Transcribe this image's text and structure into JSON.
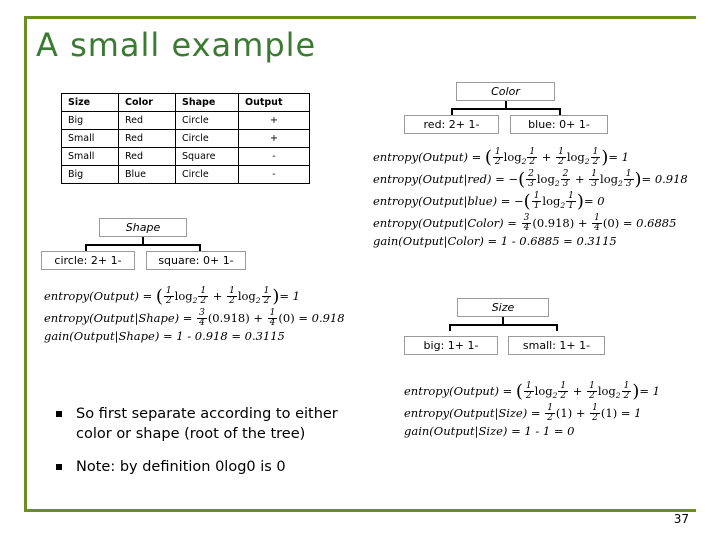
{
  "slide": {
    "title": "A small example",
    "page_number": "37"
  },
  "table": {
    "headers": [
      "Size",
      "Color",
      "Shape",
      "Output"
    ],
    "rows": [
      [
        "Big",
        "Red",
        "Circle",
        "+"
      ],
      [
        "Small",
        "Red",
        "Circle",
        "+"
      ],
      [
        "Small",
        "Red",
        "Square",
        "-"
      ],
      [
        "Big",
        "Blue",
        "Circle",
        "-"
      ]
    ]
  },
  "trees": {
    "color": {
      "root": "Color",
      "children": [
        "red: 2+ 1-",
        "blue: 0+ 1-"
      ]
    },
    "shape": {
      "root": "Shape",
      "children": [
        "circle: 2+ 1-",
        "square: 0+ 1-"
      ]
    },
    "size": {
      "root": "Size",
      "children": [
        "big: 1+ 1-",
        "small: 1+ 1-"
      ]
    }
  },
  "formulas": {
    "color": {
      "line1_label": "entropy(Output)",
      "line1_value": "= 1",
      "line2_label": "entropy(Output|red)",
      "line2_value": "= 0.918",
      "line3_label": "entropy(Output|blue)",
      "line3_value": "= 0",
      "line4_label": "entropy(Output|Color)",
      "line4_value": "= 0.6885",
      "line5": "gain(Output|Color) = 1 - 0.6885 = 0.3115"
    },
    "shape": {
      "line1_label": "entropy(Output)",
      "line1_value": "= 1",
      "line2_label": "entropy(Output|Shape)",
      "line2_value": "= 0.918",
      "line3": "gain(Output|Shape) = 1 - 0.918 = 0.3115"
    },
    "size": {
      "line1_label": "entropy(Output)",
      "line1_value": "= 1",
      "line2_label": "entropy(Output|Size)",
      "line2_value": "= 1",
      "line3": "gain(Output|Size) = 1 - 1 = 0"
    }
  },
  "bullets": [
    "So first separate according to either color or shape (root of the tree)",
    "Note: by definition 0log0 is 0"
  ]
}
